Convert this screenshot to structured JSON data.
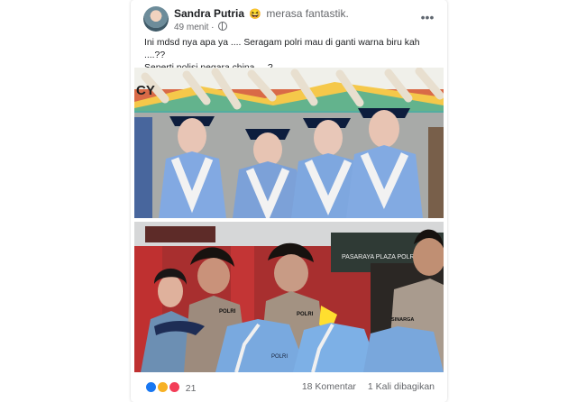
{
  "post": {
    "author": "Sandra Putria",
    "feeling_emoji": "😆",
    "feeling": "merasa fantastik.",
    "time": "49 menit",
    "more_label": "•••",
    "text_line1": "Ini mdsd nya apa ya .... Seragam polri mau di ganti warna biru kah ....??",
    "text_line2": "Seperti polisi negara china ... ?"
  },
  "reactions": {
    "count": "21",
    "comments": "18 Komentar",
    "shares": "1 Kali dibagikan"
  },
  "photo_text": {
    "banner": "CY",
    "name_tag_1": "POLRI",
    "name_tag_2": "POLRI",
    "name_tag_3": "POLRI",
    "name_tag_4": "SINARGA",
    "sign": "PASARAYA PLAZA POLRI"
  },
  "icons": {
    "avatar": "profile-photo",
    "feeling": "laughing-emoji",
    "globe": "public-globe-icon",
    "more": "more-options-icon",
    "like": "like-reaction-icon",
    "wow": "wow-reaction-icon",
    "love": "love-reaction-icon"
  }
}
